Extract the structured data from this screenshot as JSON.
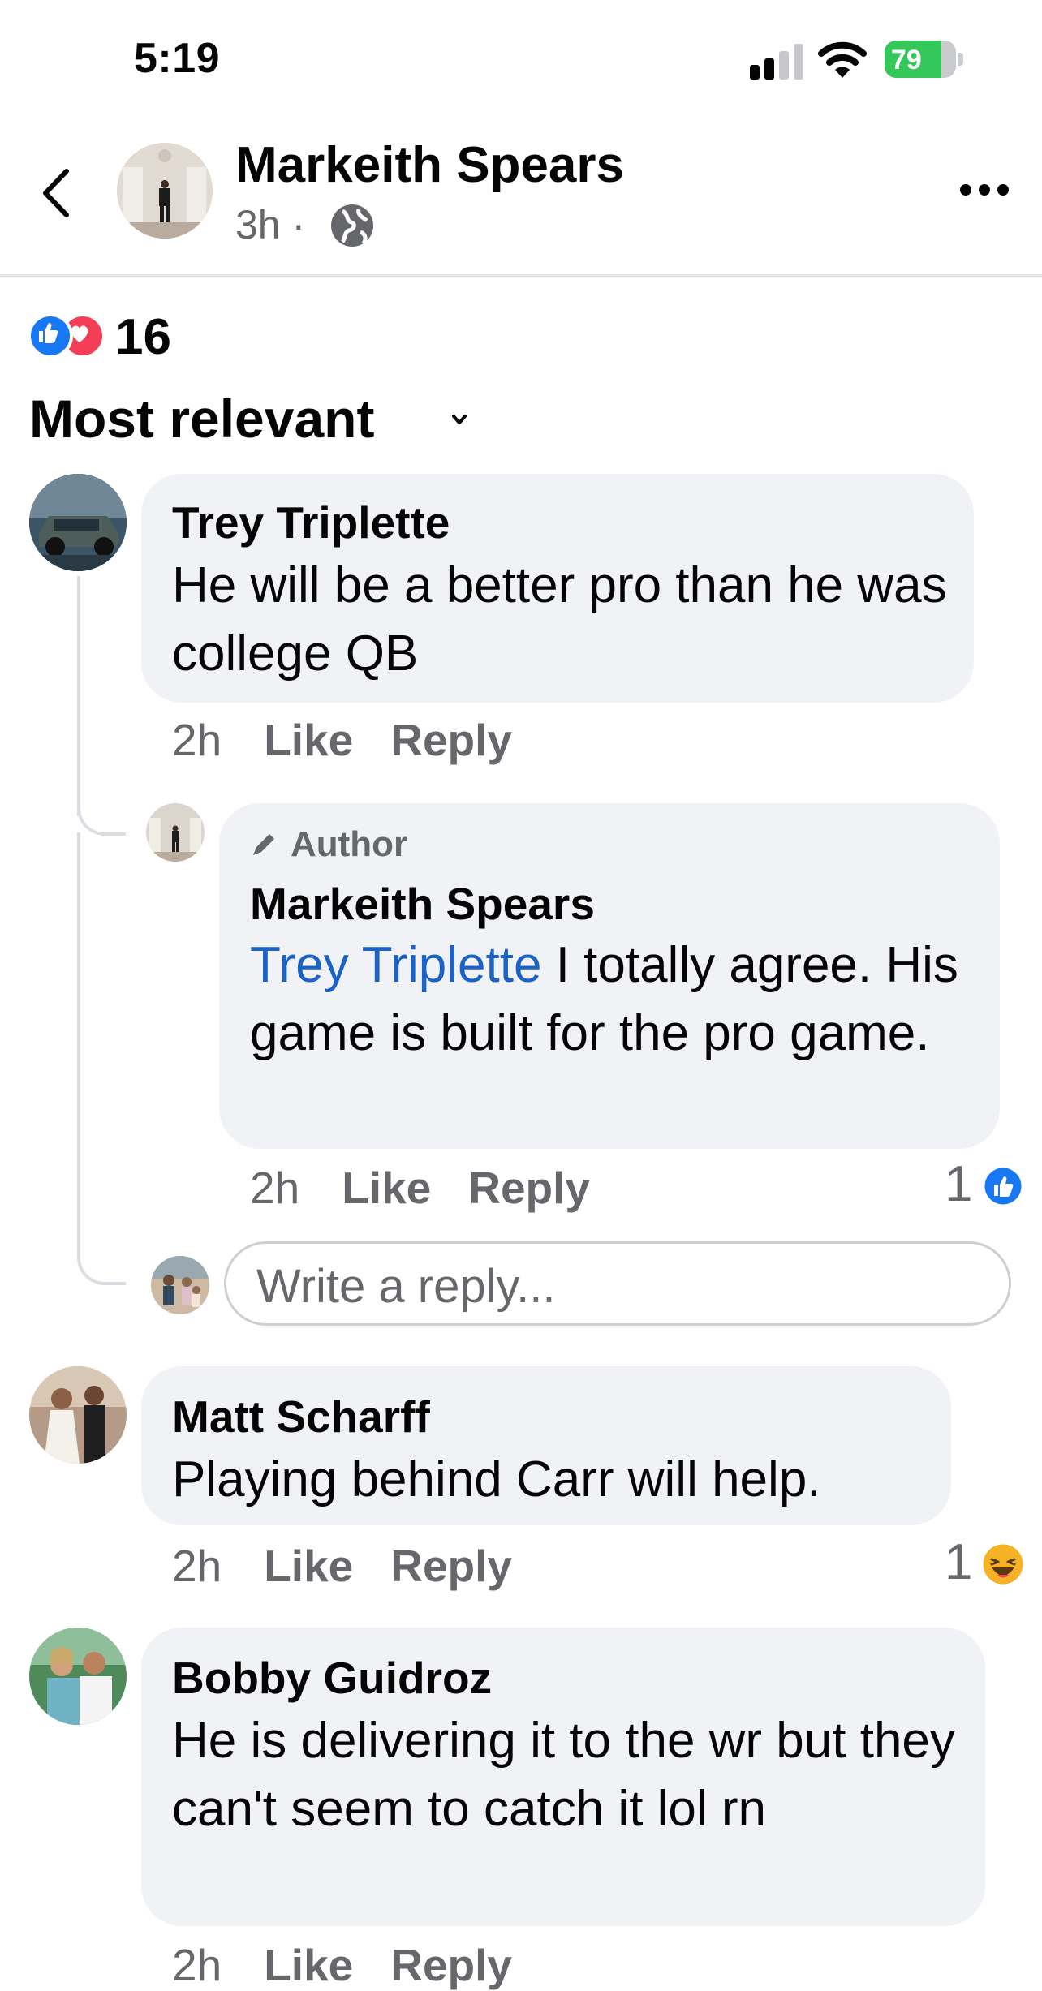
{
  "status_bar": {
    "time": "5:19",
    "battery_percent": 79,
    "battery_label": "79"
  },
  "header": {
    "name": "Markeith Spears",
    "time": "3h",
    "separator": "·",
    "privacy_icon": "globe-icon"
  },
  "reactions": {
    "count": "16",
    "types": [
      "like",
      "love"
    ]
  },
  "sort": {
    "label": "Most relevant"
  },
  "comments": [
    {
      "name": "Trey Triplette",
      "text": "He will be a better pro than he was college QB",
      "time": "2h",
      "like": "Like",
      "reply": "Reply",
      "replies": [
        {
          "badge": "Author",
          "name": "Markeith Spears",
          "mention": "Trey Triplette",
          "text": " I totally agree. His game is built for the pro game.",
          "time": "2h",
          "like": "Like",
          "reply": "Reply",
          "reaction_count": "1",
          "reaction_icon": "like-icon"
        }
      ],
      "reply_placeholder": "Write a reply..."
    },
    {
      "name": "Matt Scharff",
      "text": "Playing behind Carr will help.",
      "time": "2h",
      "like": "Like",
      "reply": "Reply",
      "reaction_count": "1",
      "reaction_icon": "haha-icon"
    },
    {
      "name": "Bobby Guidroz",
      "text": "He is delivering it to the wr but they can't seem to catch it lol rn",
      "time": "2h",
      "like": "Like",
      "reply": "Reply"
    }
  ],
  "colors": {
    "like_blue": "#1877f2",
    "love_red": "#f33e58",
    "link_blue": "#1b62c7",
    "meta_gray": "#65676b",
    "bubble_bg": "#f0f2f5"
  }
}
